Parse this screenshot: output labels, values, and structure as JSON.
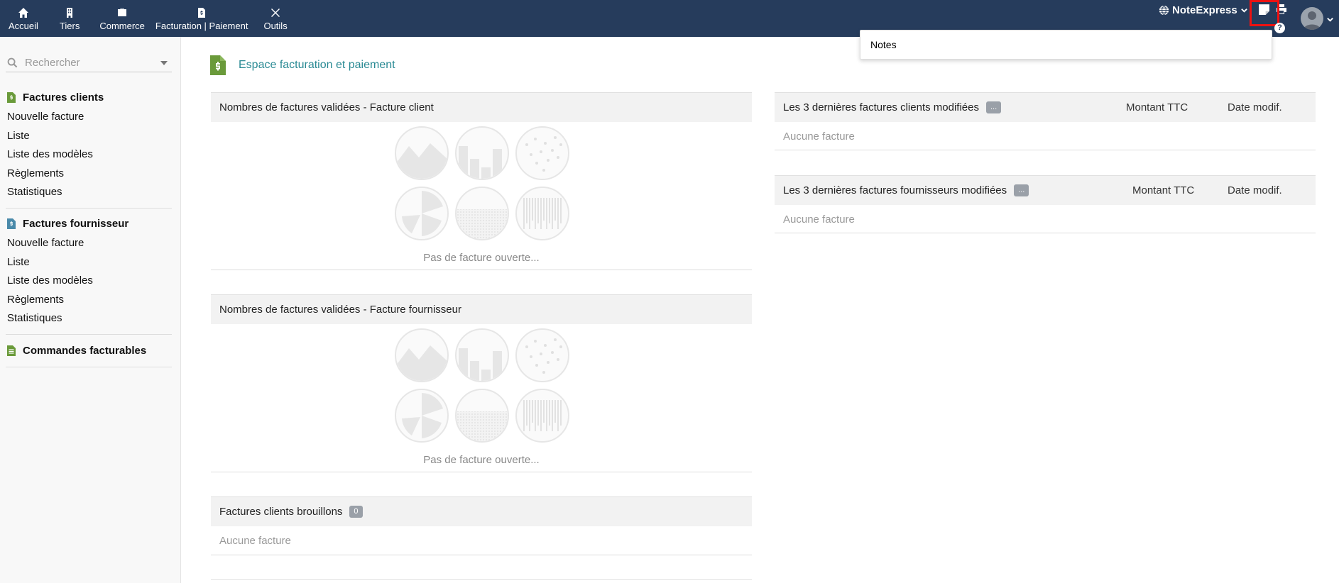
{
  "topnav": {
    "items": [
      {
        "label": "Accueil",
        "icon": "home-icon"
      },
      {
        "label": "Tiers",
        "icon": "building-icon"
      },
      {
        "label": "Commerce",
        "icon": "briefcase-icon"
      },
      {
        "label": "Facturation | Paiement",
        "icon": "invoice-icon"
      },
      {
        "label": "Outils",
        "icon": "tools-icon"
      }
    ],
    "brand": "NoteExpress",
    "help": "?"
  },
  "notes_dropdown": {
    "item": "Notes"
  },
  "sidebar": {
    "search_placeholder": "Rechercher",
    "sections": [
      {
        "title": "Factures clients",
        "links": [
          "Nouvelle facture",
          "Liste",
          "Liste des modèles",
          "Règlements",
          "Statistiques"
        ]
      },
      {
        "title": "Factures fournisseur",
        "links": [
          "Nouvelle facture",
          "Liste",
          "Liste des modèles",
          "Règlements",
          "Statistiques"
        ]
      },
      {
        "title": "Commandes facturables",
        "links": []
      }
    ]
  },
  "main": {
    "title": "Espace facturation et paiement",
    "box_client_validated": {
      "title": "Nombres de factures validées - Facture client",
      "empty": "Pas de facture ouverte..."
    },
    "box_supplier_validated": {
      "title": "Nombres de factures validées - Facture fournisseur",
      "empty": "Pas de facture ouverte..."
    },
    "box_client_drafts": {
      "title": "Factures clients brouillons",
      "badge": "0",
      "empty": "Aucune facture"
    },
    "box_last_client": {
      "title": "Les 3 dernières factures clients modifiées",
      "badge": "...",
      "col_amount": "Montant TTC",
      "col_date": "Date modif.",
      "empty": "Aucune facture"
    },
    "box_last_supplier": {
      "title": "Les 3 dernières factures fournisseurs modifiées",
      "badge": "...",
      "col_amount": "Montant TTC",
      "col_date": "Date modif.",
      "empty": "Aucune facture"
    }
  },
  "colors": {
    "topbar": "#263c5c",
    "accent": "#2a8a94",
    "icon_green": "#6a9a3a",
    "icon_blue": "#4a8aaa"
  }
}
